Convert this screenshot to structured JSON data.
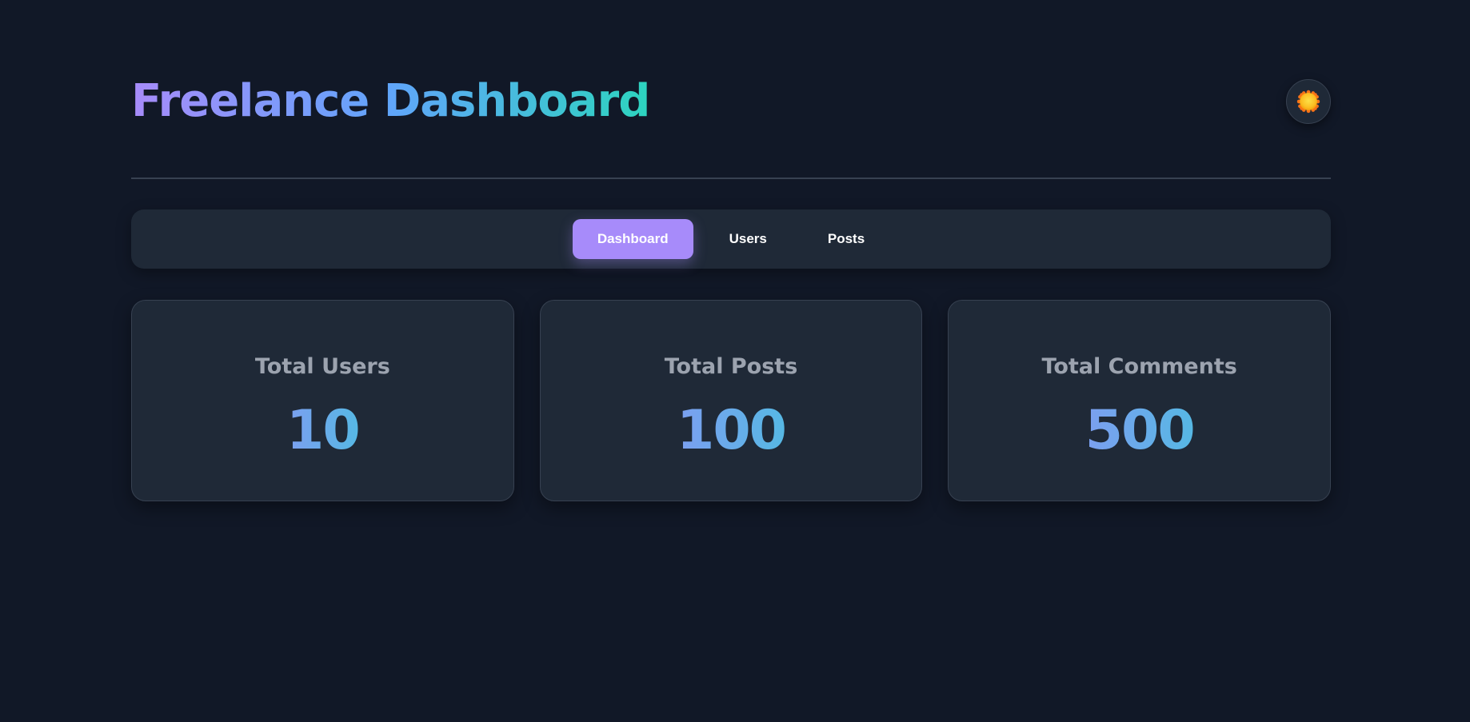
{
  "header": {
    "title": "Freelance Dashboard",
    "theme_toggle_icon": "sun-icon"
  },
  "nav": {
    "tabs": [
      {
        "label": "Dashboard",
        "active": true
      },
      {
        "label": "Users",
        "active": false
      },
      {
        "label": "Posts",
        "active": false
      }
    ]
  },
  "stats": [
    {
      "label": "Total Users",
      "value": "10"
    },
    {
      "label": "Total Posts",
      "value": "100"
    },
    {
      "label": "Total Comments",
      "value": "500"
    }
  ],
  "colors": {
    "background": "#111827",
    "surface": "#1f2937",
    "accent": "#a78bfa",
    "title_gradient": [
      "#a78bfa",
      "#60a5fa",
      "#2dd4bf"
    ]
  }
}
